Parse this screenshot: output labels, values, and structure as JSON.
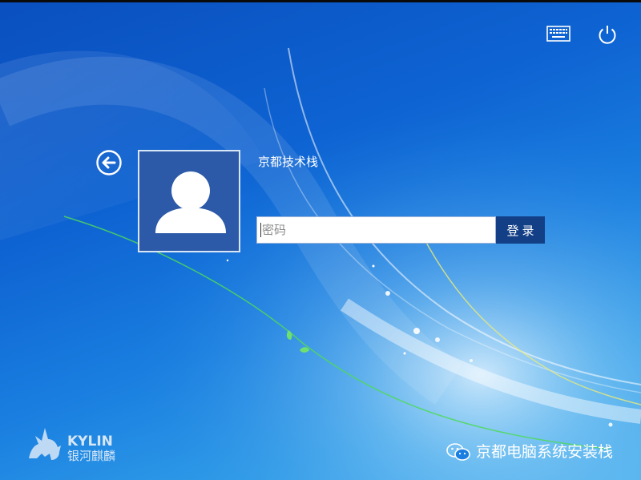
{
  "colors": {
    "background_start": "#0a4fbf",
    "background_end": "#55b8f0",
    "avatar_tile": "#2c5aa8",
    "login_button": "#123f86",
    "text": "#ffffff"
  },
  "topbar": {
    "keyboard": {
      "icon": "keyboard-icon"
    },
    "power": {
      "icon": "power-icon"
    }
  },
  "login": {
    "back": {
      "icon": "back-arrow-icon"
    },
    "avatar": {
      "icon": "user-silhouette-icon"
    },
    "username": "京都技术栈",
    "password_placeholder": "密码",
    "password_value": "",
    "login_button_label": "登录"
  },
  "branding": {
    "logo_text": "KYLIN",
    "logo_subtext": "银河麒麟",
    "logo_icon": "kylin-qilin-logo"
  },
  "watermark": {
    "icon": "wechat-icon",
    "text": "京都电脑系统安装栈"
  }
}
